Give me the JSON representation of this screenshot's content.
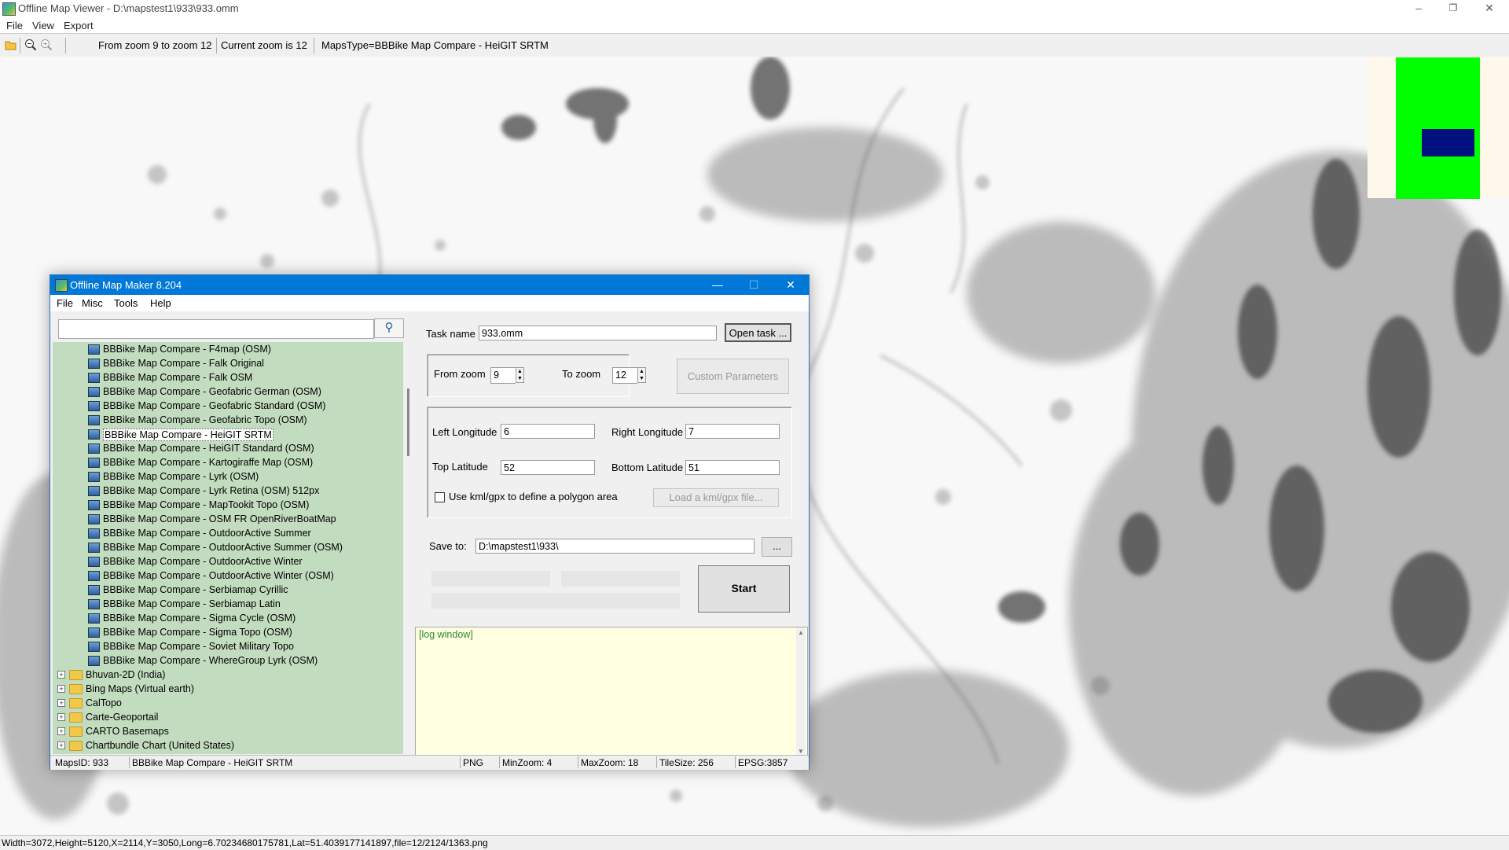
{
  "main_window": {
    "title": "Offline Map Viewer - D:\\mapstest1\\933\\933.omm",
    "controls": {
      "minimize": "–",
      "restore": "❐",
      "close": "✕"
    },
    "menu": [
      "File",
      "View",
      "Export"
    ],
    "toolbar": {
      "zoom_range": "From zoom 9 to zoom 12",
      "current_zoom": "Current zoom is 12",
      "maps_type": "MapsType=BBBike Map Compare - HeiGIT SRTM"
    },
    "status": "Width=3072,Height=5120,X=2114,Y=3050,Long=6.70234680175781,Lat=51.4039177141897,file=12/2124/1363.png"
  },
  "overview_colors": {
    "background": "#fdf8ea",
    "area": "#00ff00",
    "viewport": "#001080"
  },
  "dialog": {
    "title": "Offline Map Maker 8.204",
    "controls": {
      "minimize": "—",
      "maximize": "☐",
      "close": "✕"
    },
    "menu": [
      "File",
      "Misc",
      "Tools",
      "Help"
    ],
    "search": {
      "value": "",
      "button": "⚲"
    },
    "tree": {
      "map_items": [
        "BBBike Map Compare - F4map (OSM)",
        "BBBike Map Compare - Falk Original",
        "BBBike Map Compare - Falk OSM",
        "BBBike Map Compare - Geofabric German (OSM)",
        "BBBike Map Compare - Geofabric Standard (OSM)",
        "BBBike Map Compare - Geofabric Topo (OSM)",
        "BBBike Map Compare - HeiGIT SRTM",
        "BBBike Map Compare - HeiGIT Standard (OSM)",
        "BBBike Map Compare - Kartogiraffe Map (OSM)",
        "BBBike Map Compare - Lyrk (OSM)",
        "BBBike Map Compare - Lyrk Retina (OSM) 512px",
        "BBBike Map Compare - MapTookit Topo (OSM)",
        "BBBike Map Compare - OSM FR OpenRiverBoatMap",
        "BBBike Map Compare - OutdoorActive Summer",
        "BBBike Map Compare - OutdoorActive Summer (OSM)",
        "BBBike Map Compare - OutdoorActive Winter",
        "BBBike Map Compare - OutdoorActive Winter (OSM)",
        "BBBike Map Compare - Serbiamap Cyrillic",
        "BBBike Map Compare - Serbiamap Latin",
        "BBBike Map Compare - Sigma Cycle (OSM)",
        "BBBike Map Compare - Sigma Topo (OSM)",
        "BBBike Map Compare - Soviet Military Topo",
        "BBBike Map Compare - WhereGroup Lyrk (OSM)"
      ],
      "selected": "BBBike Map Compare - HeiGIT SRTM",
      "folders": [
        "Bhuvan-2D (India)",
        "Bing Maps (Virtual earth)",
        "CalTopo",
        "Carte-Geoportail",
        "CARTO Basemaps",
        "Chartbundle Chart (United States)"
      ]
    },
    "task": {
      "label": "Task name",
      "value": "933.omm",
      "open_button": "Open task ..."
    },
    "zoom": {
      "from_label": "From zoom",
      "from_value": "9",
      "to_label": "To zoom",
      "to_value": "12",
      "custom_button": "Custom Parameters"
    },
    "bounds": {
      "left_label": "Left Longitude",
      "left_value": "6",
      "right_label": "Right Longitude",
      "right_value": "7",
      "top_label": "Top Latitude",
      "top_value": "52",
      "bottom_label": "Bottom Latitude",
      "bottom_value": "51",
      "kml_checkbox": "Use kml/gpx to define a polygon area",
      "kml_button": "Load a kml/gpx file..."
    },
    "save": {
      "label": "Save to:",
      "value": "D:\\mapstest1\\933\\",
      "browse_button": "..."
    },
    "start_button": "Start",
    "log": "[log window]",
    "status": {
      "maps_id": "MapsID: 933",
      "map_name": "BBBike Map Compare - HeiGIT SRTM",
      "format": "PNG",
      "min_zoom": "MinZoom: 4",
      "max_zoom": "MaxZoom: 18",
      "tile_size": "TileSize: 256",
      "epsg": "EPSG:3857"
    }
  }
}
